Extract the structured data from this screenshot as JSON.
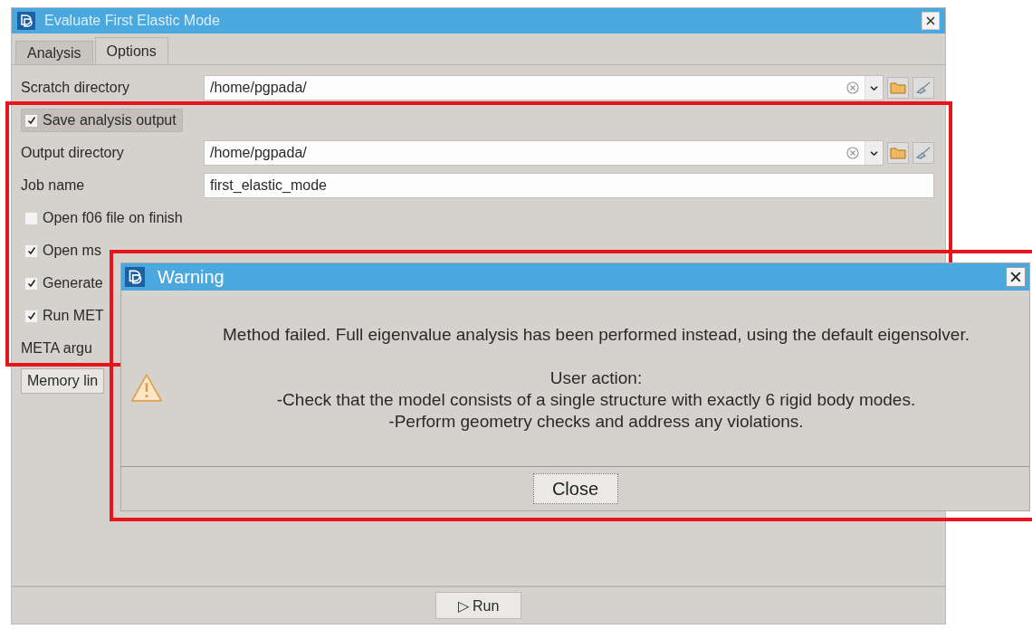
{
  "window": {
    "title": "Evaluate First Elastic Mode"
  },
  "tabs": [
    {
      "label": "Analysis",
      "selected": false
    },
    {
      "label": "Options",
      "selected": true
    }
  ],
  "form": [
    {
      "kind": "path",
      "label": "Scratch directory",
      "value": "/home/pgpada/"
    },
    {
      "kind": "checkbox",
      "label": "Save analysis output",
      "checked": true,
      "selected": true
    },
    {
      "kind": "path",
      "label": "Output directory",
      "value": "/home/pgpada/"
    },
    {
      "kind": "text",
      "label": "Job name",
      "value": "first_elastic_mode"
    },
    {
      "kind": "checkbox",
      "label": "Open f06 file on finish",
      "checked": false,
      "selected": false
    },
    {
      "kind": "checkbox",
      "label": "Open ms",
      "checked": true,
      "selected": false
    },
    {
      "kind": "checkbox",
      "label": "Generate",
      "checked": true,
      "selected": false
    },
    {
      "kind": "checkbox",
      "label": "Run MET",
      "checked": true,
      "selected": false
    },
    {
      "kind": "label",
      "label": "META argu"
    },
    {
      "kind": "button",
      "label": "Memory lin"
    }
  ],
  "run_button": {
    "icon": "▷",
    "label": "Run"
  },
  "dialog": {
    "title": "Warning",
    "message": "Method failed. Full eigenvalue analysis has been performed instead, using the default eigensolver.",
    "details": [
      "User action:",
      "-Check that the model consists of a single structure with exactly 6 rigid body modes.",
      "-Perform geometry checks and address any violations."
    ],
    "button": "Close"
  }
}
